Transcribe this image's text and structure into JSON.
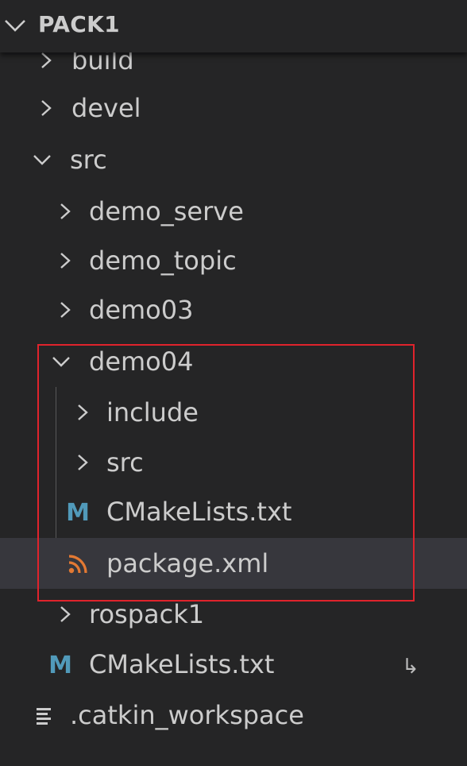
{
  "explorer": {
    "section_title": "PACK1",
    "items": [
      {
        "label": "build"
      },
      {
        "label": "devel"
      },
      {
        "label": "src"
      },
      {
        "label": "demo_serve"
      },
      {
        "label": "demo_topic"
      },
      {
        "label": "demo03"
      },
      {
        "label": "demo04"
      },
      {
        "label": "include"
      },
      {
        "label": "src"
      },
      {
        "label": "CMakeLists.txt",
        "icon_text": "M"
      },
      {
        "label": "package.xml"
      },
      {
        "label": "rospack1"
      },
      {
        "label": "CMakeLists.txt",
        "icon_text": "M"
      },
      {
        "label": ".catkin_workspace"
      }
    ]
  },
  "colors": {
    "text": "#cccccc",
    "cmake_icon": "#519aba",
    "xml_icon": "#e37933",
    "highlight": "#e0232c",
    "selected_row": "#37373d"
  }
}
